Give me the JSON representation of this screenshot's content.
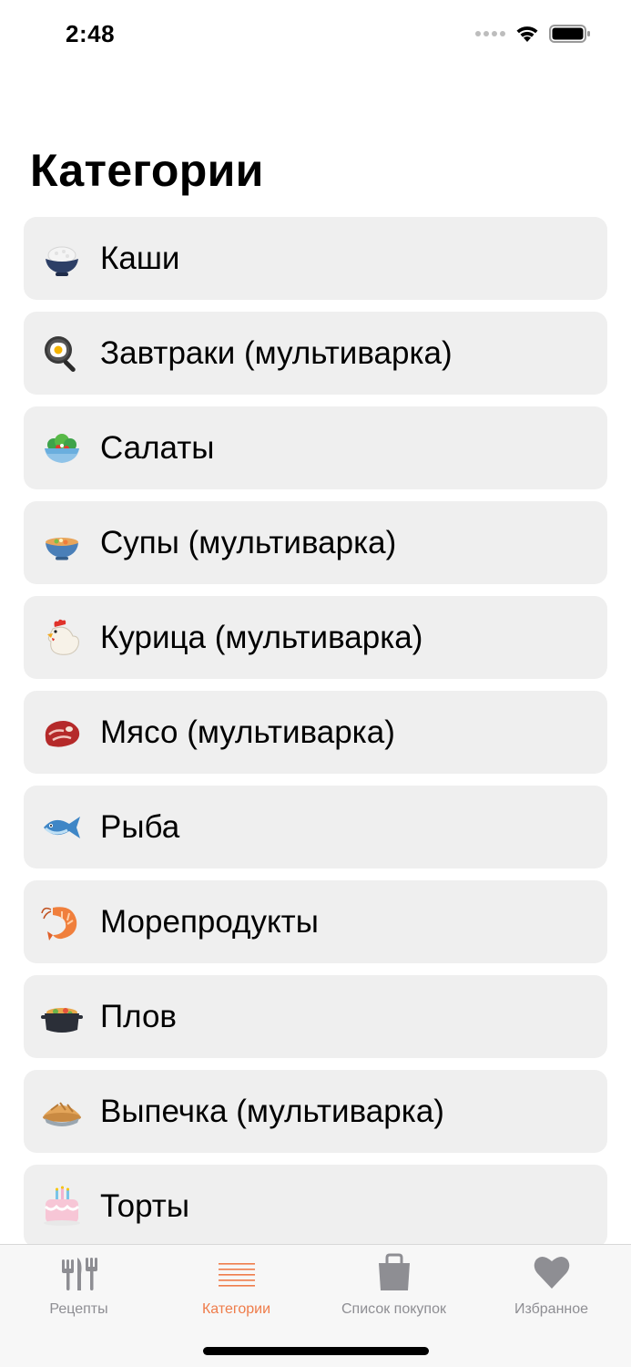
{
  "status_bar": {
    "time": "2:48"
  },
  "header": {
    "title": "Категории"
  },
  "categories": [
    {
      "label": "Каши",
      "icon": "rice-bowl-icon"
    },
    {
      "label": "Завтраки (мультиварка)",
      "icon": "frying-egg-icon"
    },
    {
      "label": "Салаты",
      "icon": "salad-icon"
    },
    {
      "label": "Супы (мультиварка)",
      "icon": "soup-bowl-icon"
    },
    {
      "label": "Курица (мультиварка)",
      "icon": "chicken-icon"
    },
    {
      "label": "Мясо (мультиварка)",
      "icon": "meat-icon"
    },
    {
      "label": "Рыба",
      "icon": "fish-icon"
    },
    {
      "label": "Морепродукты",
      "icon": "shrimp-icon"
    },
    {
      "label": "Плов",
      "icon": "pot-icon"
    },
    {
      "label": "Выпечка (мультиварка)",
      "icon": "pie-icon"
    },
    {
      "label": "Торты",
      "icon": "cake-icon"
    }
  ],
  "tab_bar": {
    "active_color": "#ef7c4a",
    "inactive_color": "#8e8e93",
    "tabs": [
      {
        "label": "Рецепты",
        "icon": "fork-knife-icon",
        "active": false
      },
      {
        "label": "Категории",
        "icon": "list-lines-icon",
        "active": true
      },
      {
        "label": "Список покупок",
        "icon": "shopping-bag-icon",
        "active": false
      },
      {
        "label": "Избранное",
        "icon": "heart-icon",
        "active": false
      }
    ]
  }
}
